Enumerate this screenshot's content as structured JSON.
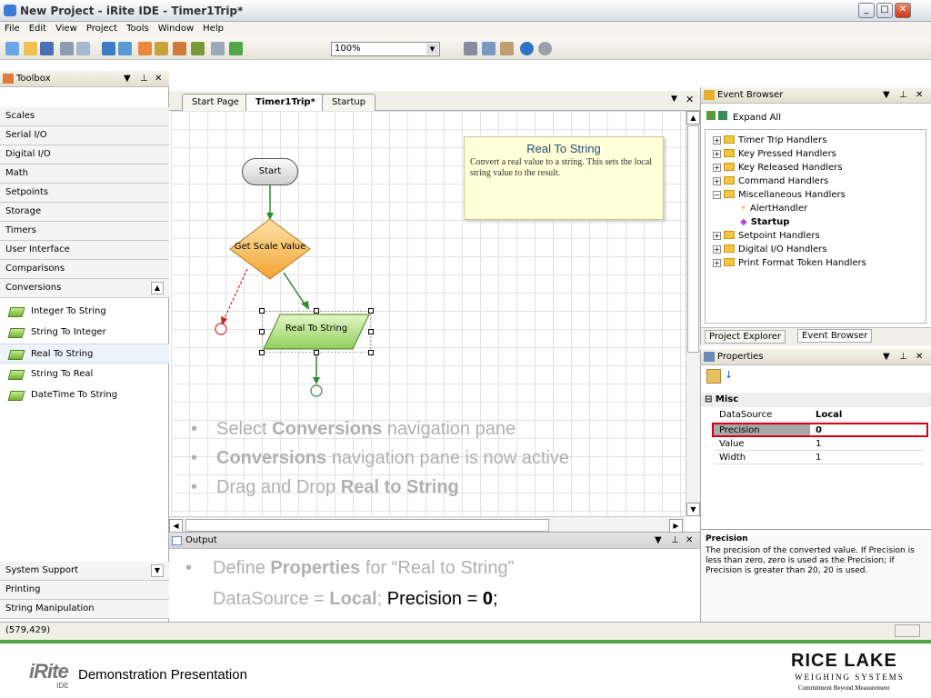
{
  "window": {
    "title": "New Project - iRite IDE - Timer1Trip*"
  },
  "menu": [
    "File",
    "Edit",
    "View",
    "Project",
    "Tools",
    "Window",
    "Help"
  ],
  "toolbar": {
    "zoom": "100%"
  },
  "toolbox": {
    "title": "Toolbox",
    "categories_top": [
      "Scales",
      "Serial I/O",
      "Digital I/O",
      "Math",
      "Setpoints",
      "Storage",
      "Timers",
      "User Interface",
      "Comparisons",
      "Conversions"
    ],
    "items": [
      "Integer To String",
      "String To Integer",
      "Real To String",
      "String To Real",
      "DateTime To String"
    ],
    "categories_bottom": [
      "System Support",
      "Printing",
      "String Manipulation"
    ]
  },
  "document": {
    "tabs": [
      "Start Page",
      "Timer1Trip*",
      "Startup"
    ],
    "tooltip_title": "Real To String",
    "tooltip_body": "Convert a real value to a string. This sets the local string value to the result.",
    "nodes": {
      "start": "Start",
      "decision": "Get Scale Value",
      "process": "Real To String"
    },
    "bullets": [
      {
        "pre": "Select ",
        "bold": "Conversions",
        "post": " navigation pane"
      },
      {
        "pre": "",
        "bold": "Conversions",
        "post": " navigation pane is now active"
      },
      {
        "pre": "Drag and Drop ",
        "bold": "Real to String",
        "post": ""
      }
    ]
  },
  "output": {
    "title": "Output",
    "line1_pre": "Define ",
    "line1_bold": "Properties",
    "line1_post": " for “Real to String”",
    "line2_a": "DataSource = ",
    "line2_b": "Local",
    "line2_c": "; ",
    "line2_d": "Precision = ",
    "line2_e": "0",
    "line2_f": ";"
  },
  "eventbrowser": {
    "title": "Event Browser",
    "expand_all": "Expand All",
    "tree": [
      "Timer Trip Handlers",
      "Key Pressed Handlers",
      "Key Released Handlers",
      "Command Handlers",
      "Miscellaneous Handlers",
      "AlertHandler",
      "Startup",
      "Setpoint Handlers",
      "Digital I/O Handlers",
      "Print Format Token Handlers"
    ],
    "tabs": [
      "Project Explorer",
      "Event Browser"
    ]
  },
  "properties": {
    "title": "Properties",
    "section": "Misc",
    "rows": [
      {
        "k": "DataSource",
        "v": "Local"
      },
      {
        "k": "Precision",
        "v": "0"
      },
      {
        "k": "Value",
        "v": "1"
      },
      {
        "k": "Width",
        "v": "1"
      }
    ],
    "desc_title": "Precision",
    "desc_body": "The precision of the converted value. If Precision is less than zero, zero is used as the Precision; if Precision is greater than 20, 20 is used."
  },
  "status": {
    "coords": "(579,429)"
  },
  "footer": {
    "logo": "iRite",
    "logo_sub": "IDE",
    "text": "Demonstration Presentation",
    "brand": "RICE LAKE",
    "brand_sub": "WEIGHING SYSTEMS",
    "tagline": "Commitment Beyond Measurement"
  },
  "colors": {
    "accent_green": "#4fa844",
    "flow_green": "#8fd05a",
    "decision_orange": "#f7b03e",
    "highlight_red": "#d0021b"
  }
}
